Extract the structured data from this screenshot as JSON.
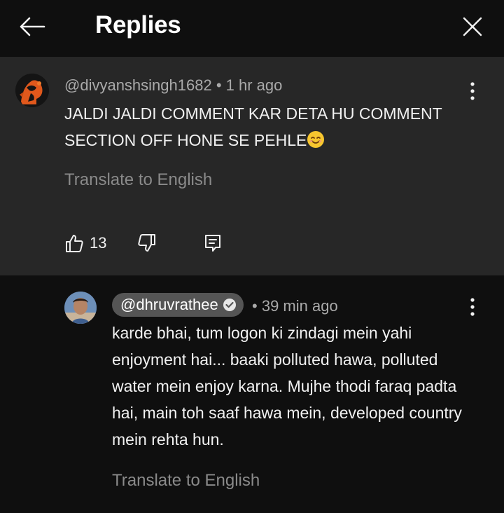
{
  "header": {
    "title": "Replies",
    "back_icon": "arrow-left-icon",
    "close_icon": "close-icon"
  },
  "parent_comment": {
    "author": "@divyanshsingh1682",
    "separator": "•",
    "time": "1 hr ago",
    "text": "JALDI JALDI COMMENT KAR DETA HU COMMENT SECTION OFF HONE SE PEHLE",
    "emoji": "smiling-face-emoji",
    "translate_label": "Translate to English",
    "likes": "13"
  },
  "reply_comment": {
    "author": "@dhruvrathee",
    "verified": true,
    "separator": "•",
    "time": "39 min ago",
    "text": "karde bhai, tum logon ki zindagi mein yahi enjoyment hai... baaki polluted hawa, polluted water mein enjoy karna. Mujhe thodi faraq padta hai, main toh saaf hawa mein, developed country mein rehta hun.",
    "translate_label": "Translate to English"
  },
  "colors": {
    "background": "#0f0f0f",
    "highlight_background": "#272727",
    "author_pill": "#555555",
    "secondary_text": "#aaaaaa"
  }
}
